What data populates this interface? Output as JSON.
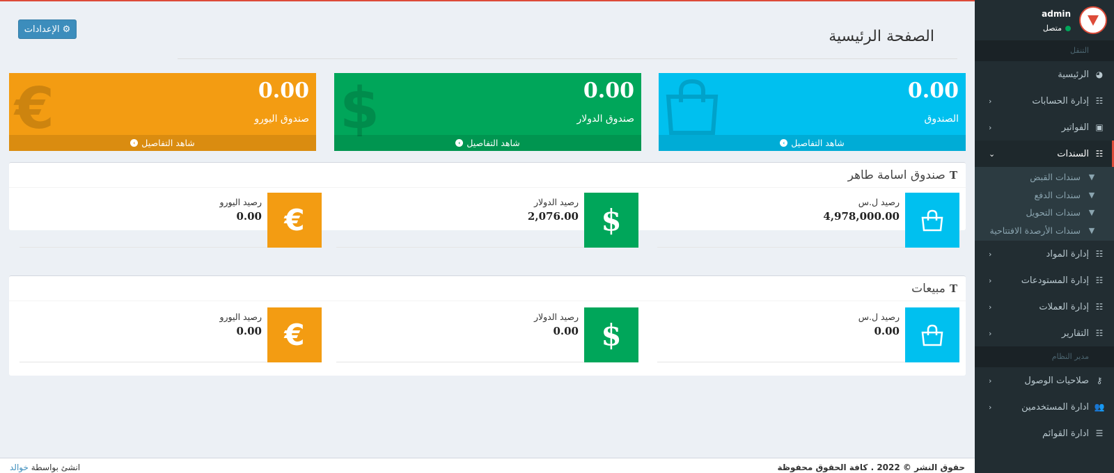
{
  "settings_button": {
    "label": "الإعدادات"
  },
  "page": {
    "title": "الصفحة الرئيسية"
  },
  "kpis": {
    "fund": {
      "value": "0.00",
      "label": "الصندوق",
      "link": "شاهد التفاصيل"
    },
    "dollar_fund": {
      "value": "0.00",
      "label": "صندوق الدولار",
      "link": "شاهد التفاصيل"
    },
    "euro_fund": {
      "value": "0.00",
      "label": "صندوق اليورو",
      "link": "شاهد التفاصيل"
    }
  },
  "box_fund": {
    "title": "صندوق اسامة طاهر",
    "items": [
      {
        "label": "رصيد ل.س",
        "value": "4,978,000.00"
      },
      {
        "label": "رصيد الدولار",
        "value": "2,076.00"
      },
      {
        "label": "رصيد اليورو",
        "value": "0.00"
      }
    ]
  },
  "box_sales": {
    "title": "مبيعات",
    "items": [
      {
        "label": "رصيد ل.س",
        "value": "0.00"
      },
      {
        "label": "رصيد الدولار",
        "value": "0.00"
      },
      {
        "label": "رصيد اليورو",
        "value": "0.00"
      }
    ]
  },
  "user": {
    "name": "admin",
    "status": "متصل"
  },
  "sidebar": {
    "nav_header": "التنقل",
    "admin_header": "مدير النظام",
    "items": {
      "home": "الرئيسية",
      "accounts": "إدارة الحسابات",
      "invoices": "الفواتير",
      "vouchers": "السندات",
      "materials": "إدارة المواد",
      "warehouses": "إدارة المستودعات",
      "currencies": "إدارة العملات",
      "reports": "التقارير",
      "access": "صلاحيات الوصول",
      "users": "ادارة المستخدمين",
      "lists": "ادارة القوائم"
    },
    "sub_items": {
      "receipt": "سندات القبض",
      "payment": "سندات الدفع",
      "transfer": "سندات التحويل",
      "opening": "سندات الأرصدة الافتتاحية"
    }
  },
  "footer": {
    "copyright": "حقوق النشر © 2022 . كافة الحقوق محفوظة",
    "credit_prefix": "انشئ بواسطة",
    "credit_link": "خوالد"
  },
  "colors": {
    "aqua": "#00c0ef",
    "green": "#00a65a",
    "orange": "#f39c12",
    "primary": "#3c8dbc",
    "sidebar": "#222d32",
    "active_border": "#dd4b39"
  }
}
